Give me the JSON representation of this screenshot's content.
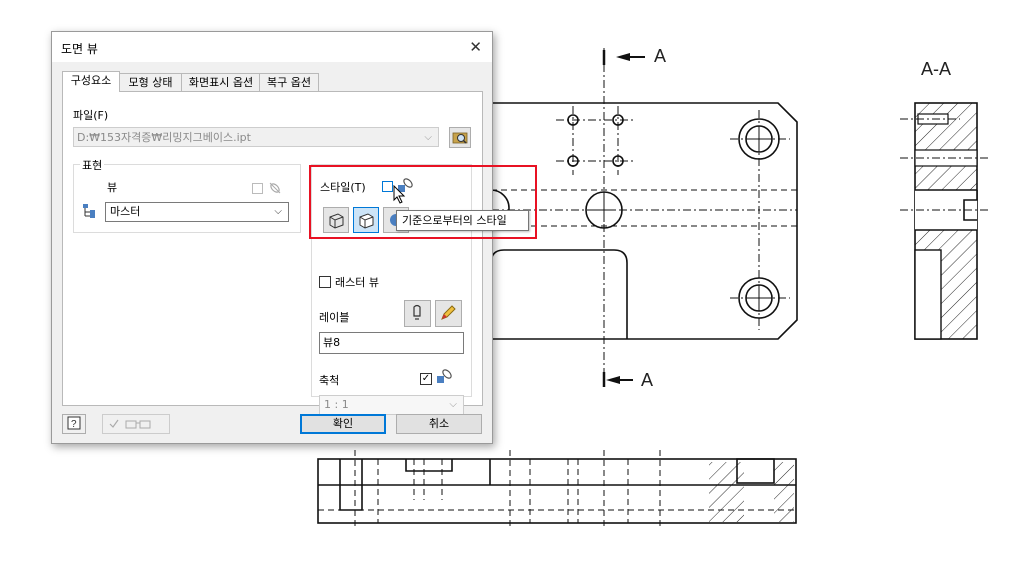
{
  "drawing": {
    "section_label_top": "A",
    "section_label_bottom": "A",
    "section_view_title": "A-A"
  },
  "dialog": {
    "title": "도면 뷰",
    "tabs": [
      "구성요소",
      "모형 상태",
      "화면표시 옵션",
      "복구 옵션"
    ],
    "file_label": "파일(F)",
    "file_path": "D:₩153자격증₩리밍지그베이스.ipt",
    "representation": {
      "group_label": "표현",
      "view_label": "뷰",
      "view_value": "마스터"
    },
    "style": {
      "label": "스타일(T)",
      "tooltip": "기준으로부터의 스타일"
    },
    "raster_view_label": "래스터 뷰",
    "label_section": {
      "label": "레이블",
      "value": "뷰8"
    },
    "scale": {
      "label": "축척",
      "value": "1 : 1"
    },
    "buttons": {
      "ok": "확인",
      "cancel": "취소"
    }
  }
}
